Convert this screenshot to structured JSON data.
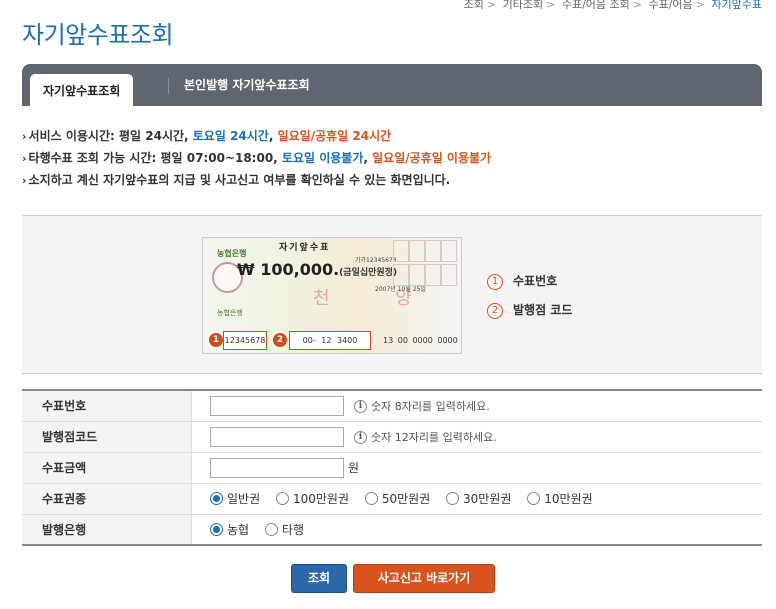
{
  "breadcrumb": [
    "조회",
    "기타조회",
    "수표/어음 조회",
    "수표/어음",
    "자기앞수표"
  ],
  "page_title": "자기앞수표조회",
  "tabs": [
    {
      "label": "자기앞수표조회",
      "active": true
    },
    {
      "label": "본인발행 자기앞수표조회",
      "active": false
    }
  ],
  "info": {
    "line1": {
      "prefix": "서비스 이용시간: 평일 24시간, ",
      "blue": "토요일 24시간",
      "mid": ", ",
      "red": "일요일/공휴일 24시간"
    },
    "line2": {
      "prefix": "타행수표 조회 가능 시간: 평일 07:00~18:00, ",
      "blue": "토요일 이용불가",
      "mid": ", ",
      "red": "일요일/공휴일 이용불가"
    },
    "line3": "소지하고 계신 자기앞수표의 지급 및 사고신고 여부를 확인하실 수 있는 화면입니다."
  },
  "sample_check": {
    "bank_name": "농협은행",
    "heading": "자기앞수표",
    "amount": "₩ 100,000.",
    "amount_korean": "(금일십만원정)",
    "top_number": "가가12345678",
    "stamp": "천 양",
    "date": "2007년 10월 25일",
    "number_box": "12345678",
    "code_box": "00- 12 3400 0000",
    "tail_number": "13 00 0000 0000",
    "marker1": "1",
    "marker2": "2"
  },
  "legend": [
    {
      "num": "1",
      "label": "수표번호"
    },
    {
      "num": "2",
      "label": "발행점 코드"
    }
  ],
  "form": {
    "check_number": {
      "label": "수표번호",
      "value": "",
      "hint": "숫자 8자리를 입력하세요."
    },
    "branch_code": {
      "label": "발행점코드",
      "value": "",
      "hint": "숫자 12자리를 입력하세요."
    },
    "amount": {
      "label": "수표금액",
      "value": "",
      "unit": "원"
    },
    "check_type": {
      "label": "수표권종",
      "options": [
        "일반권",
        "100만원권",
        "50만원권",
        "30만원권",
        "10만원권"
      ],
      "selected": "일반권"
    },
    "issuing_bank": {
      "label": "발행은행",
      "options": [
        "농협",
        "타행"
      ],
      "selected": "농협"
    }
  },
  "buttons": {
    "search": "조회",
    "report": "사고신고 바로가기"
  },
  "colors": {
    "accent_blue": "#1a6fb5",
    "accent_orange": "#d9531e",
    "tab_bar": "#5f6670"
  }
}
